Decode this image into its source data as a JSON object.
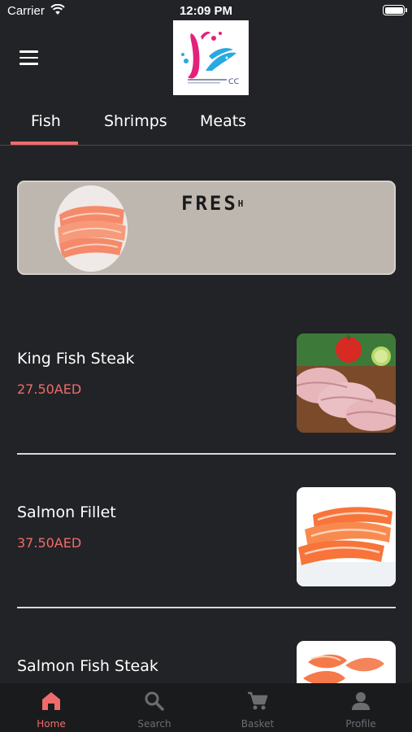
{
  "status_bar": {
    "carrier": "Carrier",
    "time": "12:09 PM"
  },
  "header": {
    "menu_icon": "hamburger-menu-icon",
    "logo": "brand-logo"
  },
  "tabs": [
    {
      "label": "Fish",
      "active": true
    },
    {
      "label": "Shrimps",
      "active": false
    },
    {
      "label": "Meats",
      "active": false
    }
  ],
  "banner": {
    "title": "FRES",
    "title_suffix": "H"
  },
  "products": [
    {
      "name": "King Fish Steak",
      "price": "27.50AED"
    },
    {
      "name": "Salmon Fillet",
      "price": "37.50AED"
    },
    {
      "name": "Salmon Fish Steak",
      "price": ""
    }
  ],
  "bottom_nav": [
    {
      "label": "Home",
      "icon": "home-icon",
      "active": true
    },
    {
      "label": "Search",
      "icon": "search-icon",
      "active": false
    },
    {
      "label": "Basket",
      "icon": "cart-icon",
      "active": false
    },
    {
      "label": "Profile",
      "icon": "person-icon",
      "active": false
    }
  ],
  "colors": {
    "accent": "#f06b6b",
    "background": "#222326",
    "nav_background": "#1a1b1d",
    "inactive": "#6b6d71"
  }
}
